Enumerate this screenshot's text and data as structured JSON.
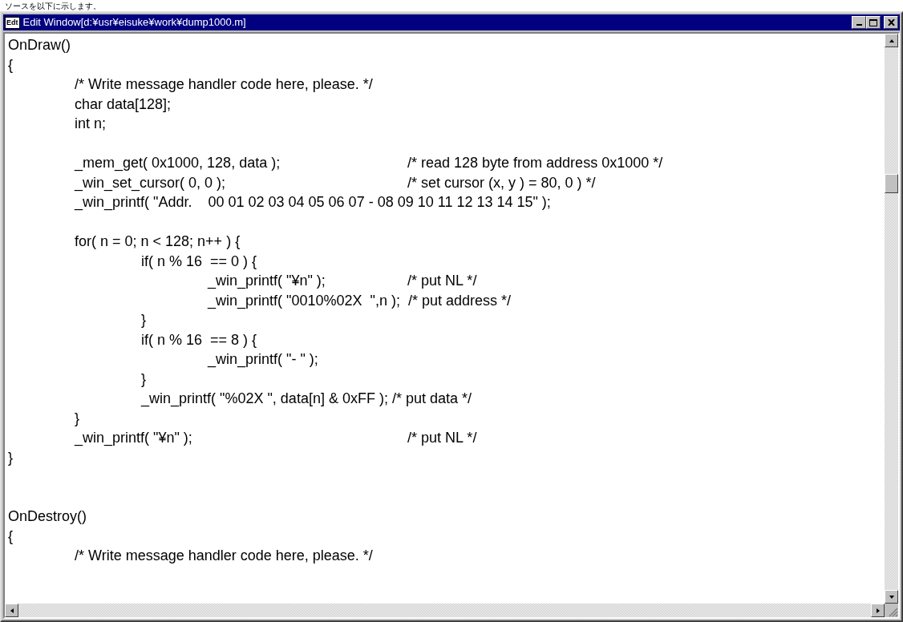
{
  "caption": "ソースを以下に示します。",
  "window": {
    "icon_label": "Edt",
    "title": "Edit Window[d:¥usr¥eisuke¥work¥dump1000.m]"
  },
  "editor": {
    "lines": [
      {
        "kind": "code",
        "text": "OnDraw()"
      },
      {
        "kind": "code",
        "text": "{"
      },
      {
        "kind": "code",
        "text": "\t/* Write message handler code here, please. */"
      },
      {
        "kind": "code",
        "text": "\tchar data[128];"
      },
      {
        "kind": "code",
        "text": "\tint n;"
      },
      {
        "kind": "blank"
      },
      {
        "kind": "code",
        "text": "\t_mem_get( 0x1000, 128, data );\t\t/* read 128 byte from address 0x1000 */"
      },
      {
        "kind": "code",
        "text": "\t_win_set_cursor( 0, 0 );\t\t\t/* set cursor (x, y ) = 80, 0 ) */"
      },
      {
        "kind": "code",
        "text": "\t_win_printf( \"Addr.    00 01 02 03 04 05 06 07 - 08 09 10 11 12 13 14 15\" );"
      },
      {
        "kind": "blank"
      },
      {
        "kind": "code",
        "text": "\tfor( n = 0; n < 128; n++ ) {"
      },
      {
        "kind": "code",
        "text": "\t\tif( n % 16  == 0 ) {"
      },
      {
        "kind": "code",
        "text": "\t\t\t_win_printf( \"¥n\" );\t\t/* put NL */"
      },
      {
        "kind": "code",
        "text": "\t\t\t_win_printf( \"0010%02X  \",n );  /* put address */"
      },
      {
        "kind": "code",
        "text": "\t\t}"
      },
      {
        "kind": "code",
        "text": "\t\tif( n % 16  == 8 ) {"
      },
      {
        "kind": "code",
        "text": "\t\t\t_win_printf( \"- \" );"
      },
      {
        "kind": "code",
        "text": "\t\t}"
      },
      {
        "kind": "code",
        "text": "\t\t_win_printf( \"%02X \", data[n] & 0xFF ); /* put data */"
      },
      {
        "kind": "code",
        "text": "\t}"
      },
      {
        "kind": "code",
        "text": "\t_win_printf( \"¥n\" );\t\t\t\t/* put NL */"
      },
      {
        "kind": "code",
        "text": "}"
      },
      {
        "kind": "blank"
      },
      {
        "kind": "blank"
      },
      {
        "kind": "code",
        "text": "OnDestroy()"
      },
      {
        "kind": "code",
        "text": "{"
      },
      {
        "kind": "code",
        "text": "\t/* Write message handler code here, please. */"
      }
    ]
  }
}
